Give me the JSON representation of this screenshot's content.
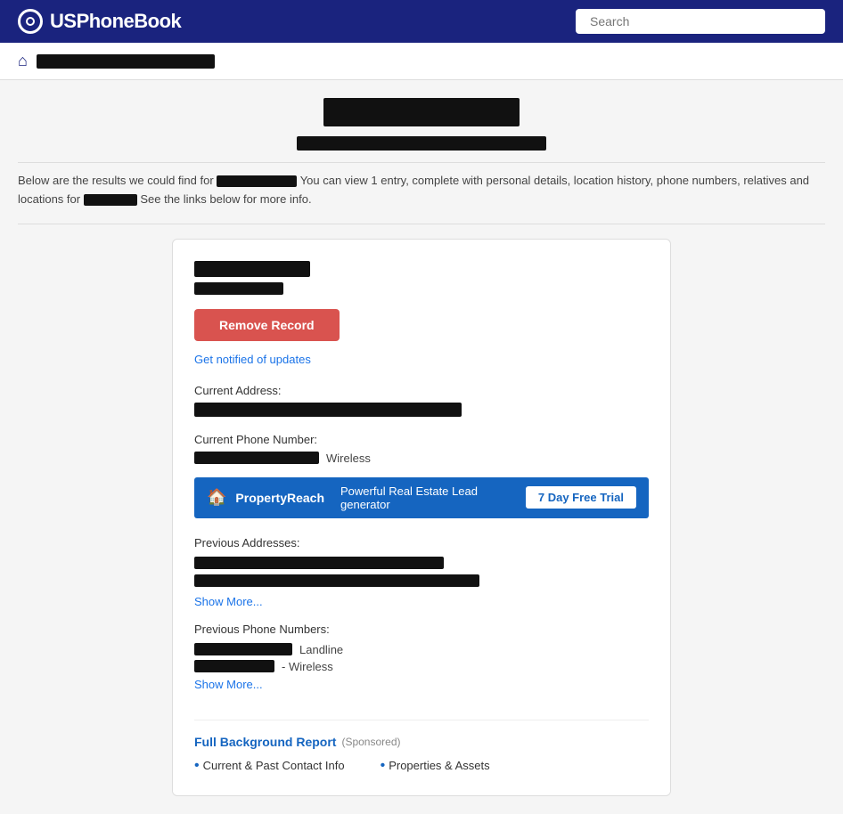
{
  "header": {
    "logo_text": "USPhoneBook",
    "logo_us": "US",
    "logo_phonebook": "PhoneBook",
    "search_placeholder": "Search"
  },
  "nav": {
    "breadcrumb_label": ""
  },
  "results": {
    "text_before": "Below are the results we could find for",
    "text_middle": "You can view 1 entry, complete with personal details, location history, phone numbers, relatives and locations for",
    "text_end": "See the links below for more info."
  },
  "card": {
    "remove_record_label": "Remove Record",
    "get_notified_label": "Get notified of updates",
    "current_address_label": "Current Address:",
    "current_phone_label": "Current Phone Number:",
    "phone_type": "Wireless",
    "property_reach_name": "PropertyReach",
    "property_reach_desc": "Powerful Real Estate Lead generator",
    "property_reach_trial": "7 Day Free Trial",
    "previous_addresses_label": "Previous Addresses:",
    "show_more_1": "Show More...",
    "previous_phones_label": "Previous Phone Numbers:",
    "landline_label": "Landline",
    "wireless_label": "- Wireless",
    "show_more_2": "Show More...",
    "full_bg_label": "Full Background Report",
    "sponsored_label": "(Sponsored)",
    "bg_col1_item": "Current & Past Contact Info",
    "bg_col2_item": "Properties & Assets"
  }
}
